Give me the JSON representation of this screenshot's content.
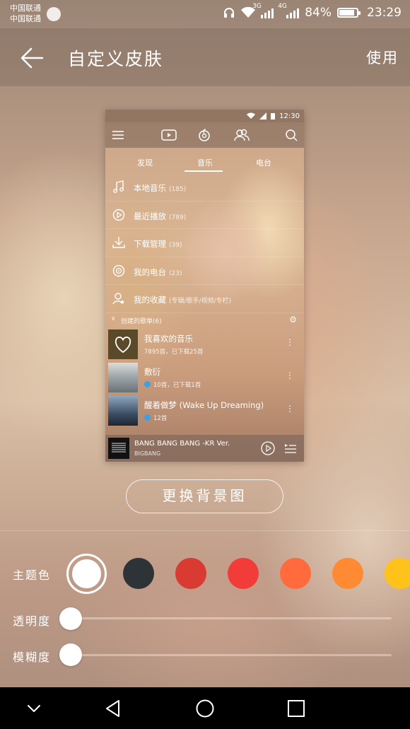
{
  "status_bar": {
    "carrier_1": "中国联通",
    "carrier_2": "中国联通",
    "net_1": "3G",
    "net_2": "4G",
    "battery_percent": "84%",
    "time": "23:29"
  },
  "header": {
    "title": "自定义皮肤",
    "use_label": "使用"
  },
  "preview": {
    "time": "12:30",
    "tabs": [
      "发现",
      "音乐",
      "电台"
    ],
    "active_tab": "音乐",
    "menu_items": [
      {
        "label": "本地音乐",
        "count": "(185)",
        "icon": "music-note-icon"
      },
      {
        "label": "最近播放",
        "count": "(789)",
        "icon": "recent-play-icon"
      },
      {
        "label": "下载管理",
        "count": "(39)",
        "icon": "download-icon"
      },
      {
        "label": "我的电台",
        "count": "(23)",
        "icon": "radio-icon"
      },
      {
        "label": "我的收藏",
        "count": "(专辑/歌手/视频/专栏)",
        "icon": "favorite-user-icon"
      }
    ],
    "section_label": "创建的歌单(6)",
    "playlists": [
      {
        "title": "我喜欢的音乐",
        "meta": "7895首，已下载25首"
      },
      {
        "title": "敷衍",
        "meta": "10首，已下载1首"
      },
      {
        "title": "醒着做梦 (Wake Up Dreaming)",
        "meta": "12首"
      }
    ],
    "player": {
      "song": "BANG BANG BANG -KR Ver.",
      "artist": "BIGBANG"
    }
  },
  "change_bg_label": "更换背景图",
  "theme": {
    "label": "主题色",
    "colors": [
      "#ffffff",
      "#2e3338",
      "#d93a32",
      "#f13c3a",
      "#ff6b3d",
      "#ff8a34",
      "#ffc21a"
    ],
    "selected_index": 0
  },
  "opacity": {
    "label": "透明度",
    "value": 0
  },
  "blur": {
    "label": "模糊度",
    "value": 0
  }
}
